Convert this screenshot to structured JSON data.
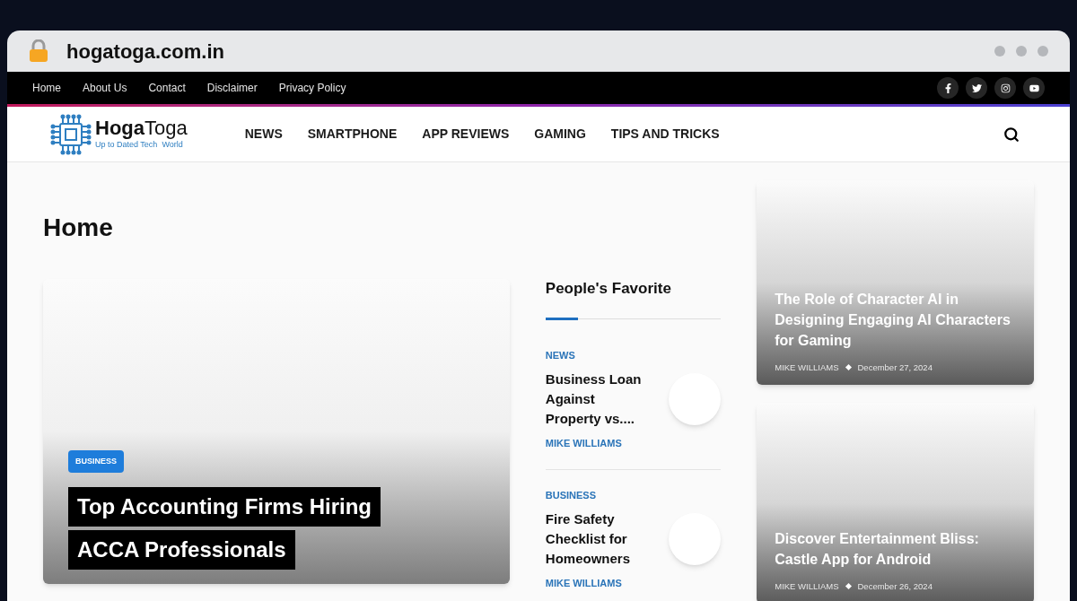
{
  "browser": {
    "url": "hogatoga.com.in"
  },
  "top_nav": [
    "Home",
    "About Us",
    "Contact",
    "Disclaimer",
    "Privacy Policy"
  ],
  "logo": {
    "name": "**Hoga**Toga",
    "tagline": "Up to Dated Tech  World"
  },
  "main_nav": [
    "NEWS",
    "SMARTPHONE",
    "APP REVIEWS",
    "GAMING",
    "TIPS AND TRICKS"
  ],
  "page_title": "Home",
  "hero": {
    "category": "BUSINESS",
    "title_lines": [
      "Top Accounting Firms Hiring",
      "ACCA Professionals"
    ]
  },
  "sidebar": {
    "title": "People's Favorite",
    "items": [
      {
        "category": "NEWS",
        "title": "Business Loan Against Property vs....",
        "author": "MIKE WILLIAMS"
      },
      {
        "category": "BUSINESS",
        "title": "Fire Safety Checklist for Homeowners",
        "author": "MIKE WILLIAMS"
      }
    ]
  },
  "featured": [
    {
      "title": "The Role of Character AI in Designing Engaging AI Characters for Gaming",
      "author": "MIKE WILLIAMS",
      "date": "December 27, 2024"
    },
    {
      "title": "Discover Entertainment Bliss: Castle App for Android",
      "author": "MIKE WILLIAMS",
      "date": "December 26, 2024"
    }
  ]
}
